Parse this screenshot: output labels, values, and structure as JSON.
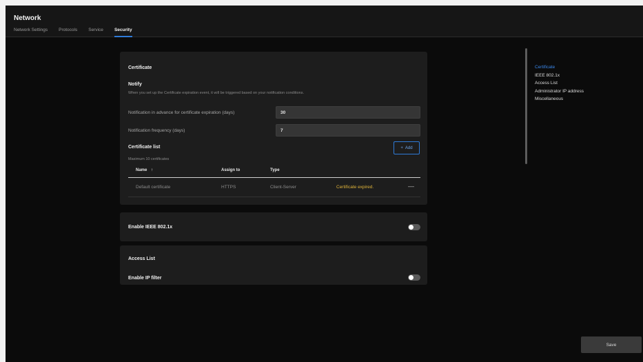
{
  "window": {
    "title": "Network"
  },
  "tabs": [
    {
      "label": "Network Settings",
      "active": false
    },
    {
      "label": "Protocols",
      "active": false
    },
    {
      "label": "Service",
      "active": false
    },
    {
      "label": "Security",
      "active": true
    }
  ],
  "certificate": {
    "title": "Certificate",
    "notify": {
      "title": "Notify",
      "description": "When you set up the Certificate expiration event, it will be triggered based on your notification conditions.",
      "advance_label": "Notification in advance for certificate expiration (days)",
      "advance_value": "30",
      "frequency_label": "Notification frequency (days)",
      "frequency_value": "7"
    },
    "list": {
      "title": "Certificate list",
      "subtitle": "Maximum 10 certificates",
      "add_label": "Add",
      "columns": [
        "Name",
        "Assign to",
        "Type"
      ],
      "rows": [
        {
          "name": "Default certificate",
          "assign_to": "HTTPS",
          "type": "Client-Server",
          "status": "Certificate expired.",
          "status_color": "#e0b43a"
        }
      ]
    }
  },
  "ieee": {
    "label": "Enable IEEE 802.1x",
    "enabled": false
  },
  "access_list": {
    "title": "Access List",
    "ip_filter_label": "Enable IP filter",
    "enabled": false
  },
  "side_nav": [
    {
      "label": "Certificate",
      "active": true
    },
    {
      "label": "IEEE 802.1x",
      "active": false
    },
    {
      "label": "Access List",
      "active": false
    },
    {
      "label": "Administrator IP address",
      "active": false
    },
    {
      "label": "Miscellaneous",
      "active": false
    }
  ],
  "footer": {
    "save_label": "Save"
  },
  "colors": {
    "accent": "#2f7bd8",
    "warning": "#e0b43a",
    "background": "#0b0b0b",
    "panel": "#1d1d1d"
  }
}
